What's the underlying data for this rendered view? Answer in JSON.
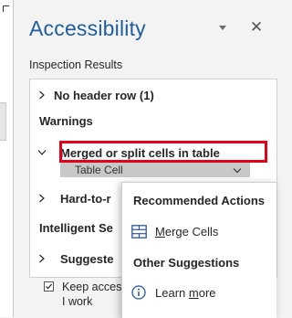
{
  "pane": {
    "title": "Accessibility",
    "subheading": "Inspection Results"
  },
  "results": {
    "no_header_row": "No header row (1)",
    "warnings_label": "Warnings",
    "merged_cells": "Merged or split cells in table",
    "table_cell": "Table Cell",
    "hard_to_read": "Hard-to-r",
    "intelligent_services": "Intelligent Se",
    "suggested": "Suggeste"
  },
  "options": {
    "keep_running_line1": "Keep accessibi",
    "keep_running_line2": "I work",
    "keep_running_checked": true
  },
  "context_menu": {
    "recommended_heading": "Recommended Actions",
    "merge_cells_label_first": "M",
    "merge_cells_label_rest": "erge Cells",
    "other_heading": "Other Suggestions",
    "learn_more_label_prefix": "Learn ",
    "learn_more_label_underlined": "m",
    "learn_more_label_suffix": "ore"
  },
  "colors": {
    "title_blue": "#1f5e9c",
    "highlight_red": "#e3001b",
    "icon_blue": "#2b579a"
  }
}
